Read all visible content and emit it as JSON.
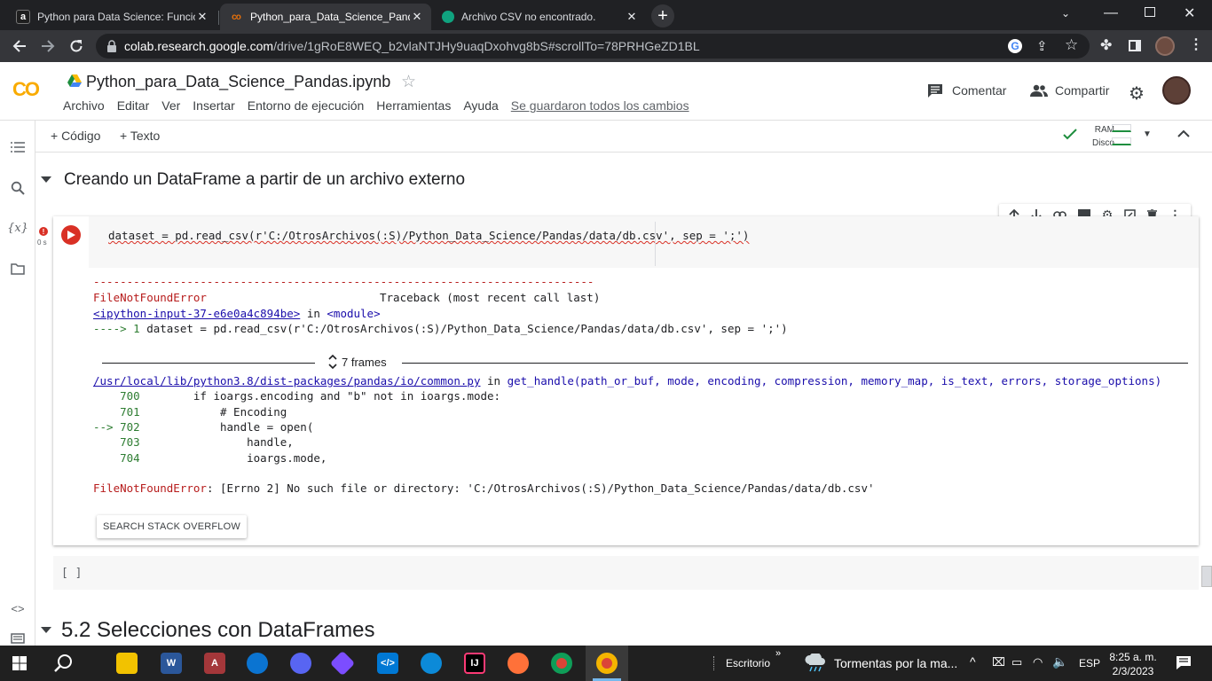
{
  "browser": {
    "tabs": [
      {
        "title": "Python para Data Science: Funcio",
        "favicon": "a",
        "favicon_color": "#ffffff",
        "favicon_bg": "#1f1f1f"
      },
      {
        "title": "Python_para_Data_Science_Panda",
        "favicon": "co",
        "favicon_color": "#f9ab00",
        "favicon_bg": "#35363a"
      },
      {
        "title": "Archivo CSV no encontrado.",
        "favicon": "gpt",
        "favicon_color": "#ffffff",
        "favicon_bg": "#202124"
      }
    ],
    "url_host": "colab.research.google.com",
    "url_path": "/drive/1gRoE8WEQ_b2vlaNTJHy9uaqDxohvg8bS#scrollTo=78PRHGeZD1BL"
  },
  "colab": {
    "logo_text": "CO",
    "notebook_title": "Python_para_Data_Science_Pandas.ipynb",
    "menu": [
      "Archivo",
      "Editar",
      "Ver",
      "Insertar",
      "Entorno de ejecución",
      "Herramientas",
      "Ayuda"
    ],
    "saved_status": "Se guardaron todos los cambios",
    "comment_label": "Comentar",
    "share_label": "Compartir",
    "add_code_label": "+ Código",
    "add_text_label": "+ Texto",
    "ram_label": "RAM",
    "disk_label": "Disco"
  },
  "notebook": {
    "section1_title": "Creando un DataFrame a partir de un archivo externo",
    "section2_title": "5.2 Selecciones con DataFrames",
    "cell1": {
      "exec_time": "0 s",
      "code": "dataset = pd.read_csv(r'C:/OtrosArchivos(:S)/Python_Data_Science/Pandas/data/db.csv', sep = ';')",
      "output": {
        "dash_line": "---------------------------------------------------------------------------",
        "error_name": "FileNotFoundError",
        "traceback_header": "Traceback (most recent call last)",
        "input_link": "<ipython-input-37-e6e0a4c894be>",
        "in_word": " in ",
        "module_name": "<module>",
        "arrow_line_prefix": "----> 1 ",
        "arrow_line_code": "dataset = pd.read_csv(r'C:/OtrosArchivos(:S)/Python_Data_Science/Pandas/data/db.csv', sep = ';')",
        "frames_label": "7 frames",
        "file_link": "/usr/local/lib/python3.8/dist-packages/pandas/io/common.py",
        "function_sig": "get_handle(path_or_buf, mode, encoding, compression, memory_map, is_text, errors, storage_options)",
        "source_lines": [
          {
            "prefix": "    700",
            "code": "        if ioargs.encoding and \"b\" not in ioargs.mode:"
          },
          {
            "prefix": "    701",
            "code": "            # Encoding"
          },
          {
            "prefix": "--> 702",
            "code": "            handle = open("
          },
          {
            "prefix": "    703",
            "code": "                handle,"
          },
          {
            "prefix": "    704",
            "code": "                ioargs.mode,"
          }
        ],
        "final_error_name": "FileNotFoundError",
        "final_error_msg": ": [Errno 2] No such file or directory: 'C:/OtrosArchivos(:S)/Python_Data_Science/Pandas/data/db.csv'",
        "search_button": "SEARCH STACK OVERFLOW"
      }
    },
    "cell2_prompt": "[ ]"
  },
  "taskbar": {
    "desktop_label": "Escritorio",
    "weather_text": "Tormentas por la ma...",
    "language": "ESP",
    "time": "8:25 a. m.",
    "date": "2/3/2023"
  }
}
